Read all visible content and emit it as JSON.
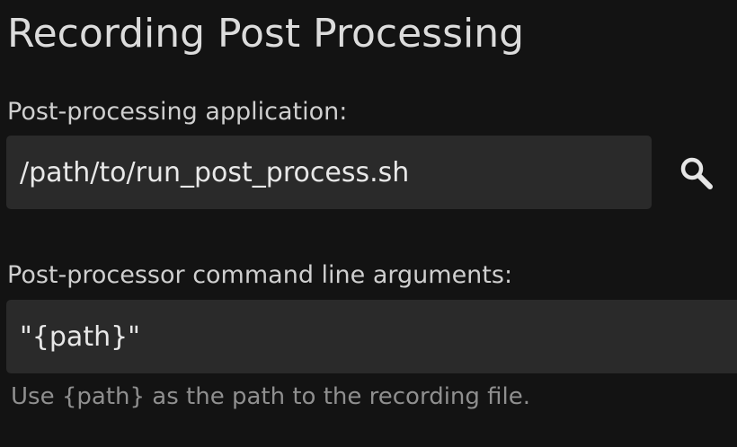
{
  "section": {
    "title": "Recording Post Processing"
  },
  "post_processing_app": {
    "label": "Post-processing application:",
    "value": "/path/to/run_post_process.sh",
    "browse_icon": "search-icon"
  },
  "post_processor_args": {
    "label": "Post-processor command line arguments:",
    "value": "\"{path}\"",
    "hint": "Use {path} as the path to the recording file."
  }
}
